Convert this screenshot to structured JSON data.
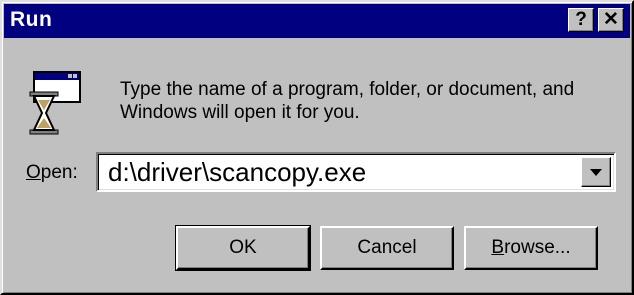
{
  "window": {
    "title": "Run",
    "help_label": "?",
    "close_label": "✕"
  },
  "dialog": {
    "icon": "run-program-icon",
    "instructions_line1": "Type the name of a program, folder, or document, and",
    "instructions_line2": "Windows will open it for you.",
    "open_label_accel": "O",
    "open_label_rest": "pen:",
    "open_value": "d:\\driver\\scancopy.exe"
  },
  "buttons": {
    "ok": "OK",
    "cancel": "Cancel",
    "browse_accel": "B",
    "browse_rest": "rowse..."
  },
  "colors": {
    "titlebar": "#000080",
    "face": "#c0c0c0"
  }
}
